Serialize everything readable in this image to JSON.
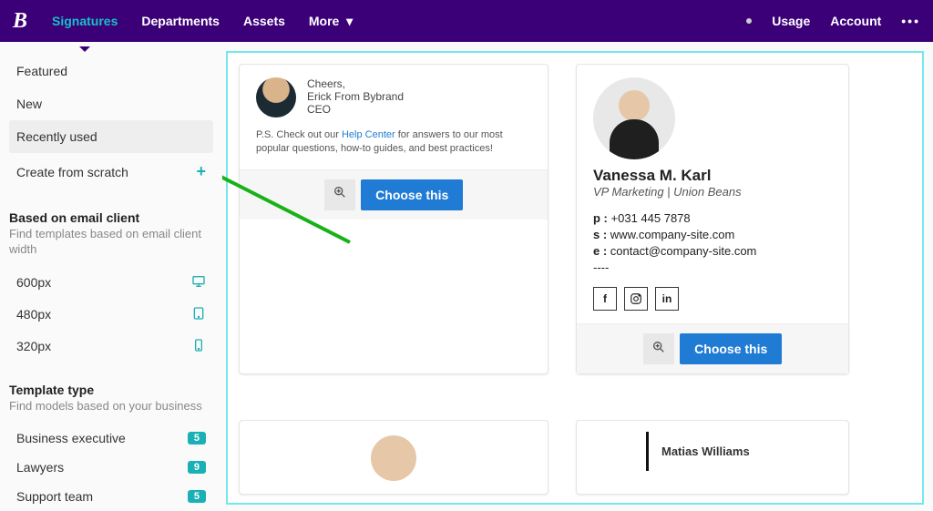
{
  "nav": {
    "logo": "B",
    "items": [
      "Signatures",
      "Departments",
      "Assets",
      "More"
    ],
    "active_index": 0,
    "right": [
      "Usage",
      "Account"
    ]
  },
  "sidebar": {
    "top_items": [
      "Featured",
      "New",
      "Recently used",
      "Create from scratch"
    ],
    "selected_index": 2,
    "section1": {
      "title": "Based on email client",
      "sub": "Find templates based on email client width",
      "rows": [
        {
          "label": "600px",
          "icon": "desktop"
        },
        {
          "label": "480px",
          "icon": "tablet"
        },
        {
          "label": "320px",
          "icon": "phone"
        }
      ]
    },
    "section2": {
      "title": "Template type",
      "sub": "Find models based on your business",
      "rows": [
        {
          "label": "Business executive",
          "count": "5"
        },
        {
          "label": "Lawyers",
          "count": "9"
        },
        {
          "label": "Support team",
          "count": "5"
        }
      ]
    }
  },
  "cards": {
    "choose_label": "Choose this",
    "sig1": {
      "greeting": "Cheers,",
      "name": "Erick From Bybrand",
      "title": "CEO",
      "ps_prefix": "P.S. Check out our ",
      "ps_link": "Help Center",
      "ps_suffix": " for answers to our most popular questions, how-to guides, and best practices!"
    },
    "sig2": {
      "name": "Vanessa M. Karl",
      "role": "VP Marketing | Union Beans",
      "phone_label": "p :",
      "phone": "+031 445 7878",
      "site_label": "s :",
      "site": "www.company-site.com",
      "email_label": "e :",
      "email": "contact@company-site.com",
      "dashes": "----"
    },
    "sig4_name": "Matias Williams"
  }
}
